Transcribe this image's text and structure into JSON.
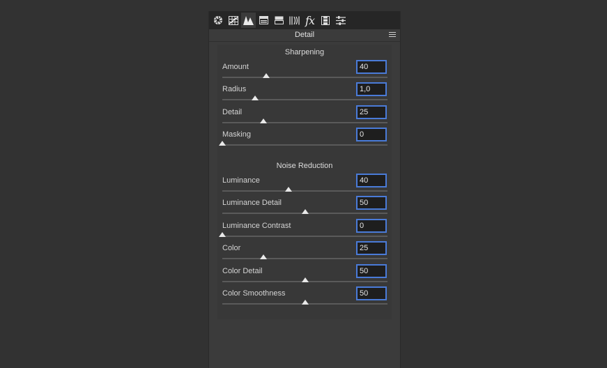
{
  "toolbar": {
    "tools": [
      {
        "name": "basic-icon",
        "active": false
      },
      {
        "name": "tone-curve-icon",
        "active": false
      },
      {
        "name": "detail-icon",
        "active": true
      },
      {
        "name": "hsl-icon",
        "active": false
      },
      {
        "name": "split-toning-icon",
        "active": false
      },
      {
        "name": "lens-corrections-icon",
        "active": false
      },
      {
        "name": "effects-icon",
        "active": false
      },
      {
        "name": "camera-calibration-icon",
        "active": false
      },
      {
        "name": "presets-icon",
        "active": false
      }
    ],
    "effects_glyph": "fx"
  },
  "header": {
    "title": "Detail"
  },
  "sharpening": {
    "title": "Sharpening",
    "rows": [
      {
        "label": "Amount",
        "value": "40",
        "min": 0,
        "max": 150,
        "level": 40
      },
      {
        "label": "Radius",
        "value": "1,0",
        "min": 0.5,
        "max": 3.0,
        "level": 1.0
      },
      {
        "label": "Detail",
        "value": "25",
        "min": 0,
        "max": 100,
        "level": 25
      },
      {
        "label": "Masking",
        "value": "0",
        "min": 0,
        "max": 100,
        "level": 0
      }
    ]
  },
  "noise_reduction": {
    "title": "Noise Reduction",
    "rows": [
      {
        "label": "Luminance",
        "value": "40",
        "min": 0,
        "max": 100,
        "level": 40
      },
      {
        "label": "Luminance Detail",
        "value": "50",
        "min": 0,
        "max": 100,
        "level": 50
      },
      {
        "label": "Luminance Contrast",
        "value": "0",
        "min": 0,
        "max": 100,
        "level": 0
      },
      {
        "label": "Color",
        "value": "25",
        "min": 0,
        "max": 100,
        "level": 25
      },
      {
        "label": "Color Detail",
        "value": "50",
        "min": 0,
        "max": 100,
        "level": 50
      },
      {
        "label": "Color Smoothness",
        "value": "50",
        "min": 0,
        "max": 100,
        "level": 50
      }
    ]
  },
  "colors": {
    "input_border": "#4a7bd8",
    "panel_bg": "#3b3b3b",
    "toolbar_bg": "#262626"
  }
}
